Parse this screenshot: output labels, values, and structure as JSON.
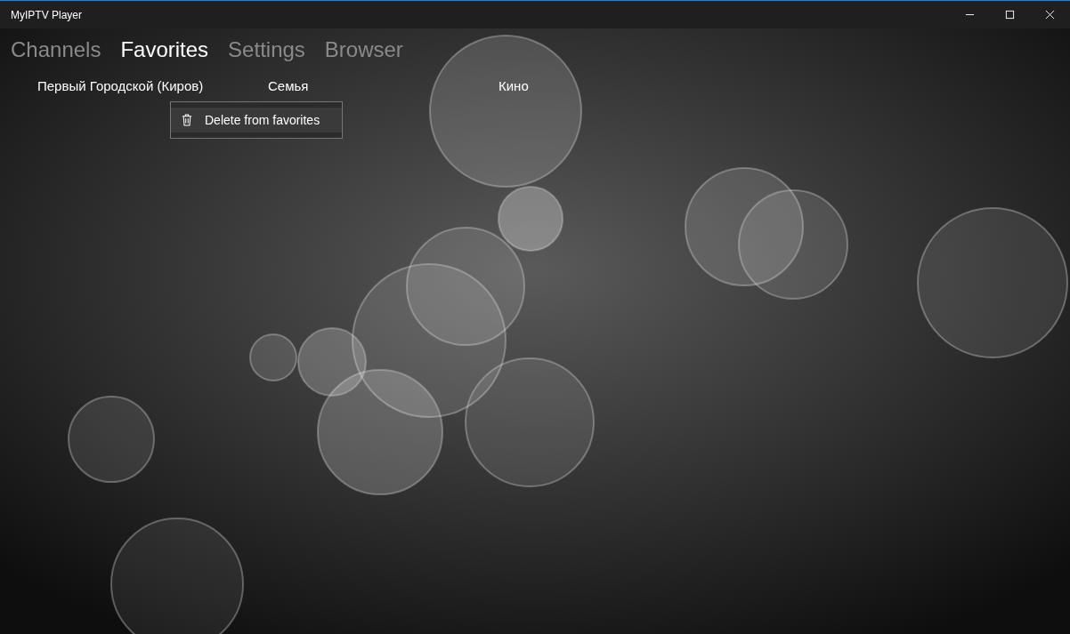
{
  "window": {
    "title": "MyIPTV Player"
  },
  "tabs": [
    {
      "label": "Channels",
      "selected": false
    },
    {
      "label": "Favorites",
      "selected": true
    },
    {
      "label": "Settings",
      "selected": false
    },
    {
      "label": "Browser",
      "selected": false
    }
  ],
  "favorites": [
    "Первый Городской (Киров)",
    "Семья",
    "Кино"
  ],
  "context_menu": {
    "items": [
      {
        "label": "Delete from favorites"
      }
    ]
  },
  "background": {
    "kind": "picture"
  }
}
